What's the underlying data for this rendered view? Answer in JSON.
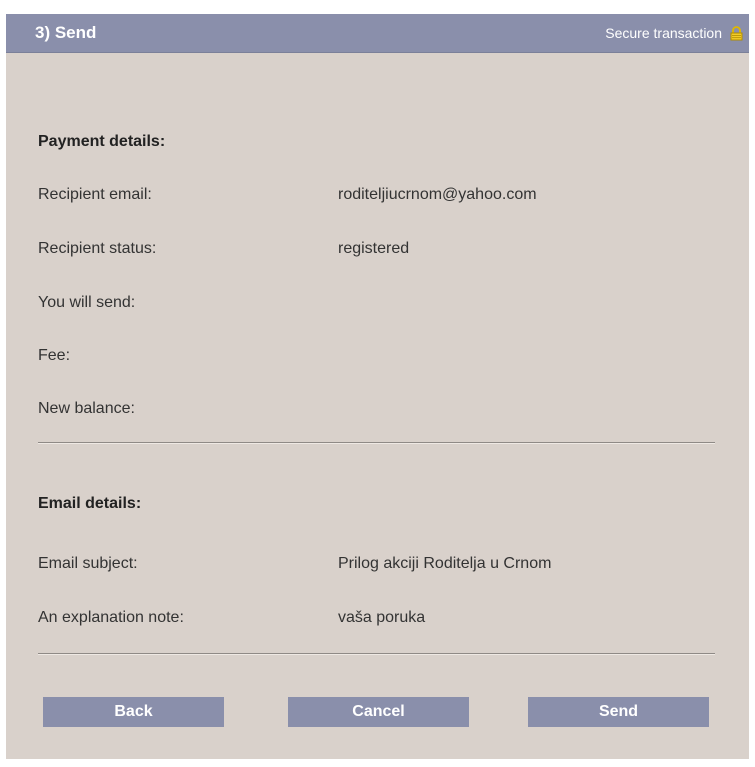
{
  "header": {
    "title": "3) Send",
    "secure_text": "Secure transaction",
    "lock_icon": "lock-icon"
  },
  "payment": {
    "section_title": "Payment details:",
    "rows": [
      {
        "label": "Recipient email:",
        "value": "roditeljiucrnom@yahoo.com"
      },
      {
        "label": "Recipient status:",
        "value": "registered"
      },
      {
        "label": "You will send:",
        "value": ""
      },
      {
        "label": "Fee:",
        "value": ""
      },
      {
        "label": "New balance:",
        "value": ""
      }
    ]
  },
  "email": {
    "section_title": "Email details:",
    "rows": [
      {
        "label": "Email subject:",
        "value": "Prilog akciji Roditelja u Crnom"
      },
      {
        "label": "An explanation note:",
        "value": "vaša poruka"
      }
    ]
  },
  "buttons": {
    "back": "Back",
    "cancel": "Cancel",
    "send": "Send"
  },
  "colors": {
    "header_bg": "#8a8fab",
    "panel_bg": "#d9d1cb",
    "lock": "#e0b800"
  }
}
